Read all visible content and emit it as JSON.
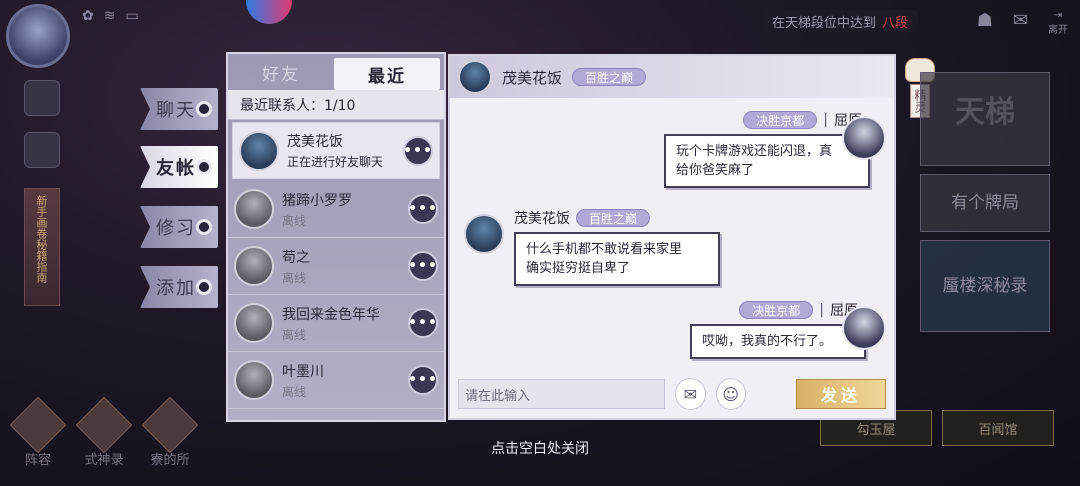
{
  "topbar": {
    "ladder_notice_prefix": "在天梯段位中达到",
    "ladder_notice_red": "八段",
    "leave_label": "离开"
  },
  "sidetabs": [
    {
      "label": "聊天",
      "active": false
    },
    {
      "label": "友帐",
      "active": true
    },
    {
      "label": "修习",
      "active": false
    },
    {
      "label": "添加",
      "active": false
    }
  ],
  "contacts": {
    "tab_friends": "好友",
    "tab_recent": "最近",
    "recent_header": "最近联系人：1/10",
    "list": [
      {
        "name": "茂美花饭",
        "status": "正在进行好友聊天",
        "online": true
      },
      {
        "name": "猪蹄小罗罗",
        "status": "离线",
        "online": false
      },
      {
        "name": "苟之",
        "status": "离线",
        "online": false
      },
      {
        "name": "我回来金色年华",
        "status": "离线",
        "online": false
      },
      {
        "name": "叶墨川",
        "status": "离线",
        "online": false
      }
    ]
  },
  "chat": {
    "partner_name": "茂美花饭",
    "partner_title": "百胜之巅",
    "messages": [
      {
        "sender": "me",
        "server": "决胜京都",
        "name": "屈原",
        "text_line1": "玩个卡牌游戏还能闪退，真",
        "text_line2": "给你爸笑麻了"
      },
      {
        "sender": "partner",
        "name": "茂美花饭",
        "title": "百胜之巅",
        "text_line1": "什么手机都不敢说看来家里",
        "text_line2": "确实挺穷挺自卑了"
      },
      {
        "sender": "me",
        "server": "决胜京都",
        "name": "屈原",
        "text_line1": "哎呦，我真的不行了。"
      }
    ],
    "input_placeholder": "请在此输入",
    "send_label": "发送"
  },
  "right": {
    "spirit_label": "精灵",
    "ladder_title": "天梯",
    "card_game_label": "有个牌局",
    "tower_label": "蜃楼深秘录",
    "gouyu_label": "勾玉屋",
    "baiwen_label": "百闻馆"
  },
  "bottom_left": [
    "阵容",
    "式神录",
    "寮的所"
  ],
  "left_banner": "新手画卷秘籍指南",
  "close_hint": "点击空白处关闭"
}
